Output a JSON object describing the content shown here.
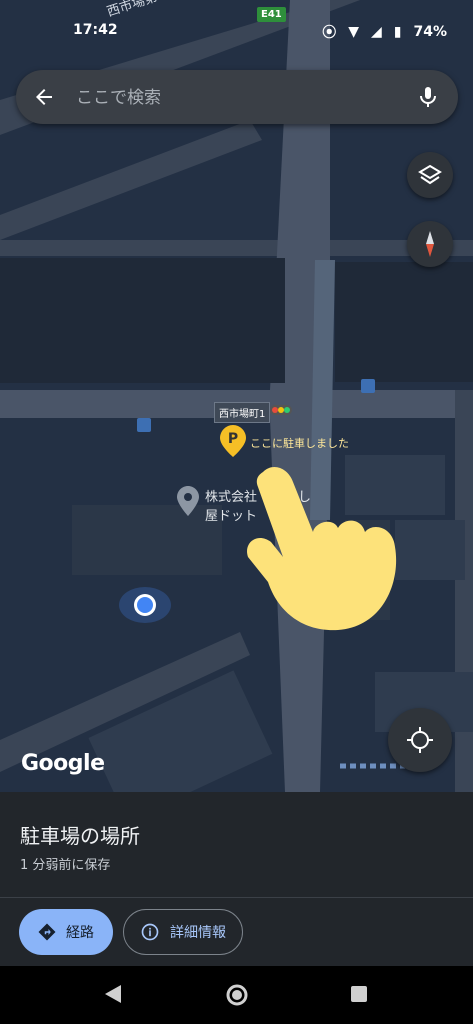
{
  "status_bar": {
    "time": "17:42",
    "battery": "74%"
  },
  "map": {
    "street_top": "西市場第二橋",
    "road_badge": "E41",
    "station_label": "西市場町1",
    "parking_label": "ここに駐車しました",
    "poi_label_line1": "株式会社",
    "poi_label_line2": "屋ドット",
    "poi_fragment": "し",
    "logo": "Google"
  },
  "search": {
    "placeholder": "ここで検索"
  },
  "sheet": {
    "title": "駐車場の場所",
    "subtitle": "1 分弱前に保存",
    "route_label": "経路",
    "details_label": "詳細情報"
  },
  "colors": {
    "accent": "#8ab4f8",
    "parking_pin": "#f6bf26",
    "location_dot": "#4285f4"
  }
}
